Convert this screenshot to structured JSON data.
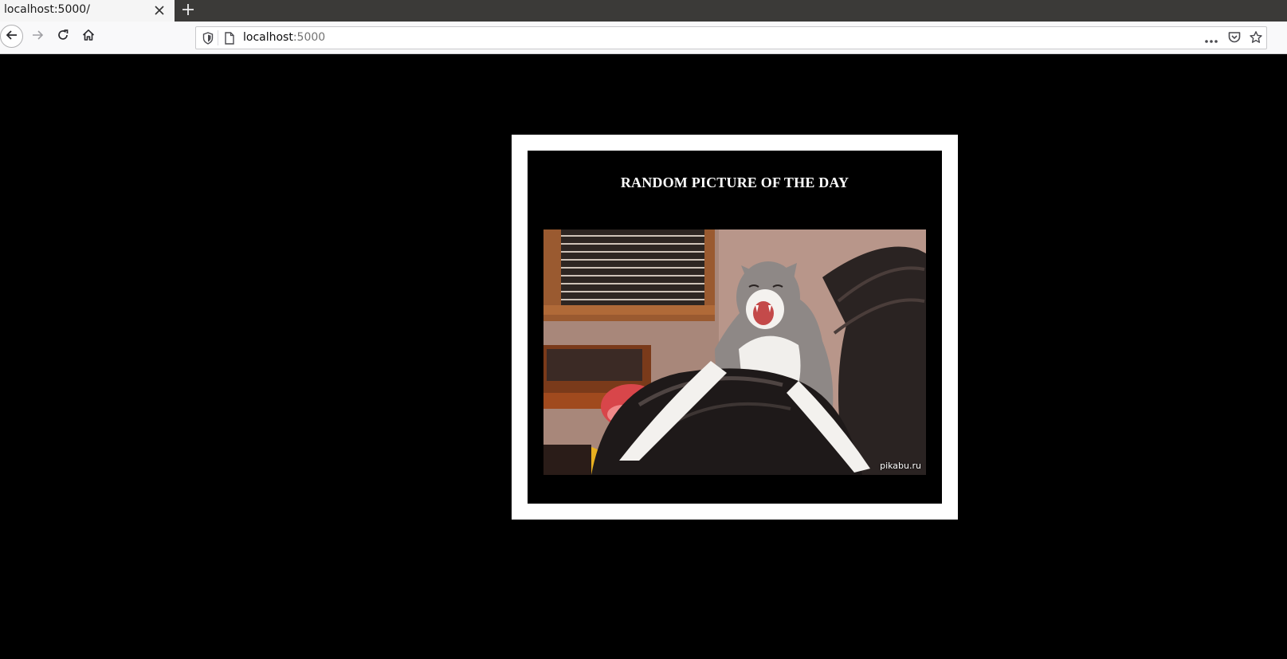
{
  "browser": {
    "tab_title": "localhost:5000/",
    "url_host": "localhost",
    "url_port": ":5000"
  },
  "page": {
    "heading": "RANDOM PICTURE OF THE DAY",
    "picture_watermark": "pikabu.ru",
    "background_color": "#000000",
    "frame_color": "#ffffff"
  },
  "icons": {
    "tab_close": "close-icon",
    "new_tab": "plus-icon",
    "back": "arrow-left-icon",
    "forward": "arrow-right-icon",
    "reload": "reload-icon",
    "home": "home-icon",
    "shield": "shield-icon",
    "page": "page-icon",
    "more": "more-icon",
    "pocket": "pocket-icon",
    "bookmark": "star-icon"
  }
}
